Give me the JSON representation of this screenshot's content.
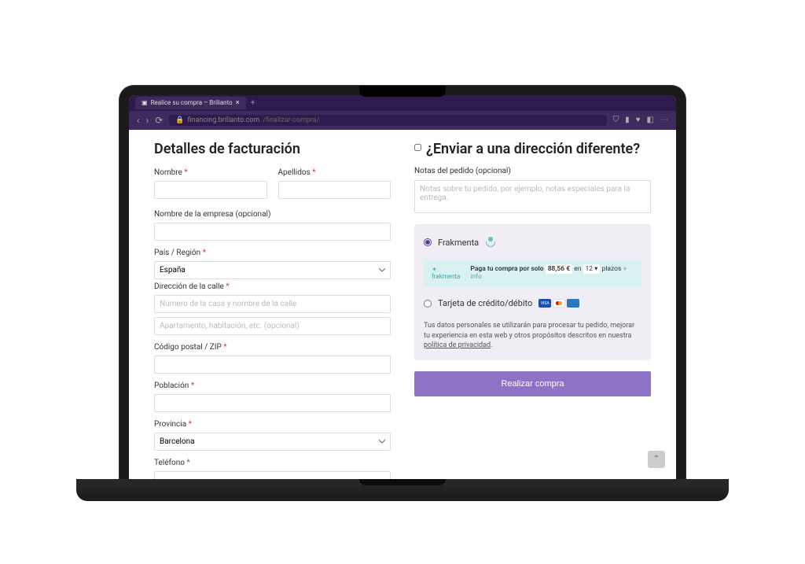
{
  "browser": {
    "tab_title": "Realice su compra – Brilianto",
    "url_host": "financing.brilianto.com",
    "url_path": "/finalizar-compra/"
  },
  "billing": {
    "heading": "Detalles de facturación",
    "first_name_label": "Nombre",
    "last_name_label": "Apellidos",
    "company_label": "Nombre de la empresa (opcional)",
    "country_label": "País / Región",
    "country_value": "España",
    "street_label": "Dirección de la calle",
    "street_ph1": "Número de la casa y nombre de la calle",
    "street_ph2": "Apartamento, habitación, etc. (opcional)",
    "zip_label": "Código postal / ZIP",
    "city_label": "Población",
    "province_label": "Provincia",
    "province_value": "Barcelona",
    "phone_label": "Teléfono"
  },
  "shipping": {
    "heading": "¿Enviar a una dirección diferente?",
    "notes_label": "Notas del pedido (opcional)",
    "notes_ph": "Notas sobre tu pedido, por ejemplo, notas especiales para la entrega."
  },
  "payment": {
    "frakmenta_label": "Frakmenta",
    "banner_brand": "frakmenta",
    "banner_text_1": "Paga tu compra por solo",
    "banner_amount": "88,56 €",
    "banner_text_2": "en",
    "banner_plazos": "12",
    "banner_text_3": "plazos",
    "banner_info": "+ info",
    "card_label": "Tarjeta de crédito/débito",
    "privacy_text": "Tus datos personales se utilizarán para procesar tu pedido, mejorar tu experiencia en esta web y otros propósitos descritos en nuestra ",
    "privacy_link": "política de privacidad",
    "submit_label": "Realizar compra"
  }
}
